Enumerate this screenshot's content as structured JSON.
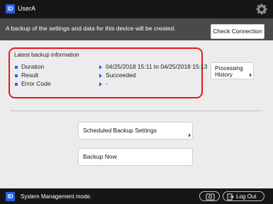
{
  "header": {
    "badge": "ID",
    "username": "UserA"
  },
  "info": {
    "message": "A backup of the settings and data for this device will be created.",
    "check_connection_label": "Check Connection"
  },
  "backup_info": {
    "title": "Latest backup information",
    "rows": [
      {
        "label": "Duration",
        "value": "04/25/2018 15:11 to 04/25/2018 15:13"
      },
      {
        "label": "Result",
        "value": "Succeeded"
      },
      {
        "label": "Error Code",
        "value": "-"
      }
    ]
  },
  "buttons": {
    "processing_history_line1": "Processing",
    "processing_history_line2": "History",
    "scheduled_backup_settings": "Scheduled Backup Settings",
    "backup_now": "Backup Now"
  },
  "footer": {
    "badge": "ID",
    "mode_text": "System Management mode.",
    "logout_label": "Log Out"
  },
  "colors": {
    "accent_blue": "#2a5ee8",
    "highlight_red": "#e8191f",
    "bar_dark": "#161616",
    "info_gray": "#4a4a4a",
    "panel_bg": "#ececec"
  }
}
